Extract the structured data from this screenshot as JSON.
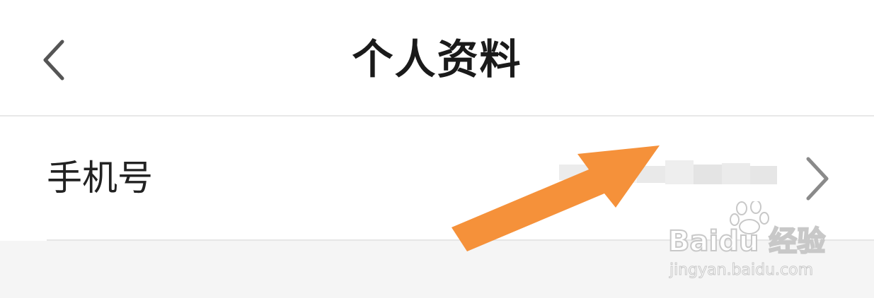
{
  "header": {
    "title": "个人资料",
    "back_icon": "chevron-left-icon"
  },
  "profile": {
    "rows": [
      {
        "label": "手机号",
        "value_masked": true,
        "chevron_icon": "chevron-right-icon"
      }
    ]
  },
  "annotation": {
    "arrow_color": "#f5913a"
  },
  "watermark": {
    "brand": "Baidu 经验",
    "url": "jingyan.baidu.com"
  },
  "colors": {
    "background": "#ffffff",
    "footer_background": "#f5f5f5",
    "divider": "#e8e8e8",
    "title_text": "#1a1a1a",
    "label_text": "#222222",
    "chevron": "#8a8a8a"
  }
}
